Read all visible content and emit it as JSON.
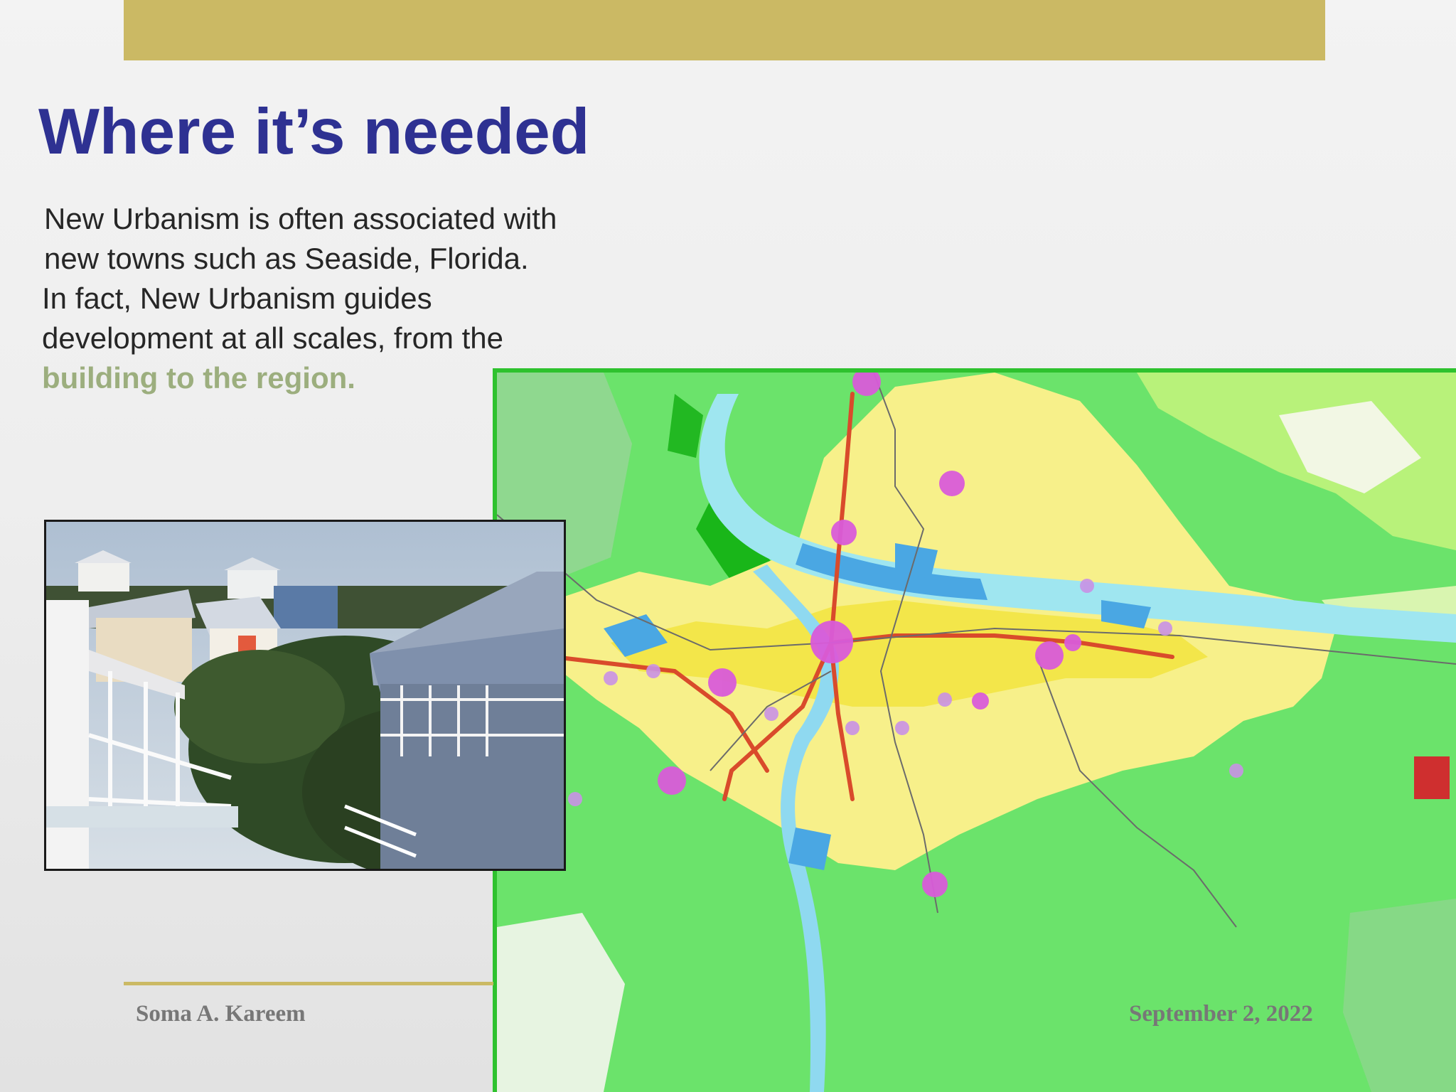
{
  "slide": {
    "title": "Where it’s needed",
    "body_lines": [
      "New Urbanism is often associated with",
      "new towns such as Seaside, Florida.",
      "In fact, New Urbanism guides",
      "development at all scales, from the"
    ],
    "body_highlight": "building to the region.",
    "footer_author": "Soma A. Kareem",
    "footer_date": "September 2, 2022"
  },
  "images": {
    "photo": "seaside-florida-houses-photo",
    "map": "portland-region-growth-map"
  },
  "colors": {
    "accent_bar": "#cbb964",
    "title": "#2e3192",
    "highlight": "#9cae7e",
    "map_border": "#2ec22e"
  }
}
